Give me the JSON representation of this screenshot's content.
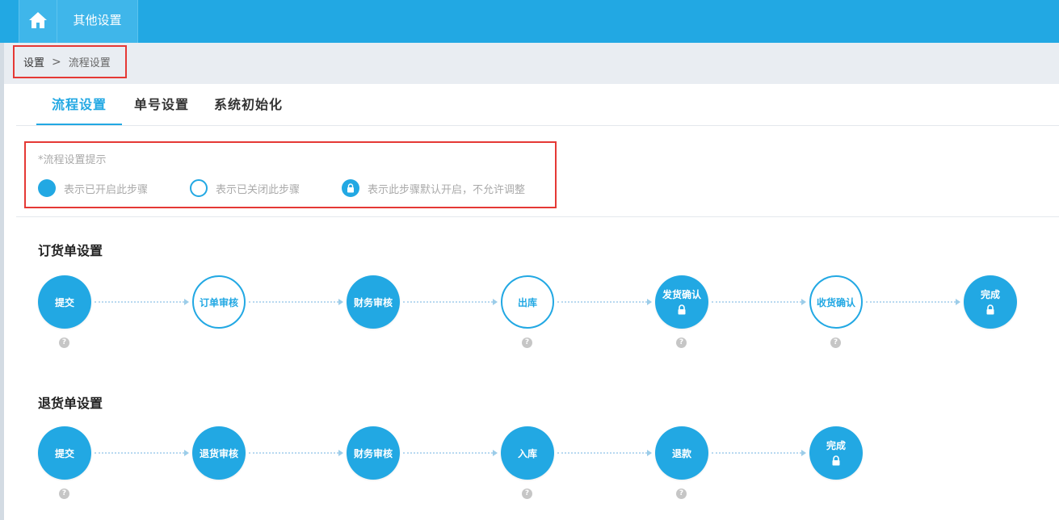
{
  "topbar": {
    "home_icon": "home-icon",
    "tab_label": "其他设置"
  },
  "breadcrumb": {
    "root": "设置",
    "separator": ">",
    "current": "流程设置"
  },
  "tabs": [
    {
      "label": "流程设置",
      "active": true
    },
    {
      "label": "单号设置",
      "active": false
    },
    {
      "label": "系统初始化",
      "active": false
    }
  ],
  "tips": {
    "title": "*流程设置提示",
    "legend": [
      {
        "type": "filled",
        "label": "表示已开启此步骤"
      },
      {
        "type": "hollow",
        "label": "表示已关闭此步骤"
      },
      {
        "type": "locked",
        "label": "表示此步骤默认开启，不允许调整"
      }
    ]
  },
  "order_flow": {
    "title": "订货单设置",
    "steps": [
      {
        "label": "提交",
        "state": "filled",
        "locked": false,
        "help": true
      },
      {
        "label": "订单审核",
        "state": "hollow",
        "locked": false,
        "help": false
      },
      {
        "label": "财务审核",
        "state": "filled",
        "locked": false,
        "help": false
      },
      {
        "label": "出库",
        "state": "hollow",
        "locked": false,
        "help": true
      },
      {
        "label": "发货确认",
        "state": "filled",
        "locked": true,
        "help": true
      },
      {
        "label": "收货确认",
        "state": "hollow",
        "locked": false,
        "help": true
      },
      {
        "label": "完成",
        "state": "filled",
        "locked": true,
        "help": false
      }
    ]
  },
  "return_flow": {
    "title": "退货单设置",
    "steps": [
      {
        "label": "提交",
        "state": "filled",
        "locked": false,
        "help": true
      },
      {
        "label": "退货审核",
        "state": "filled",
        "locked": false,
        "help": false
      },
      {
        "label": "财务审核",
        "state": "filled",
        "locked": false,
        "help": false
      },
      {
        "label": "入库",
        "state": "filled",
        "locked": false,
        "help": true
      },
      {
        "label": "退款",
        "state": "filled",
        "locked": false,
        "help": true
      },
      {
        "label": "完成",
        "state": "filled",
        "locked": true,
        "help": false
      }
    ]
  },
  "help_glyph": "?",
  "colors": {
    "primary": "#22a8e3",
    "highlight_border": "#e53935",
    "muted_text": "#aaaaaa",
    "help_icon": "#c6c6c6"
  }
}
